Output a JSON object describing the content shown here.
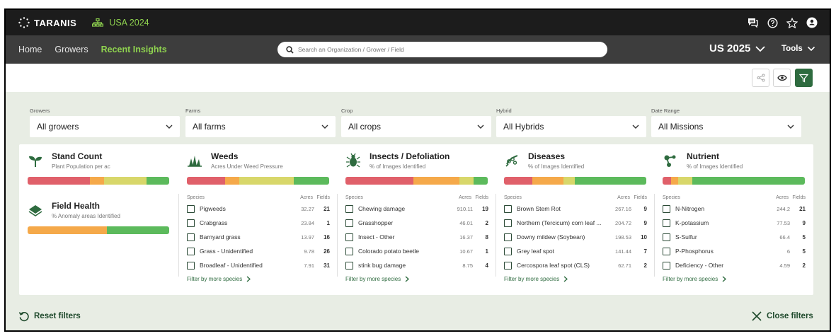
{
  "app": {
    "brand": "TARANIS",
    "region": "USA 2024"
  },
  "nav": {
    "items": [
      "Home",
      "Growers",
      "Recent Insights"
    ],
    "search_placeholder": "Search an Organization / Grower / Field",
    "season": "US 2025",
    "tools": "Tools"
  },
  "filters": [
    {
      "label": "Growers",
      "value": "All growers"
    },
    {
      "label": "Farms",
      "value": "All farms"
    },
    {
      "label": "Crop",
      "value": "All crops"
    },
    {
      "label": "Hybrid",
      "value": "All Hybrids"
    },
    {
      "label": "Date Range",
      "value": "All Missions"
    }
  ],
  "columns": [
    {
      "title": "Stand Count",
      "subtitle": "Plant Population per ac",
      "icon": "seedling-icon",
      "bar": [
        0.44,
        0.1,
        0.3,
        0.16
      ],
      "extra": {
        "title": "Field Health",
        "subtitle": "% Anomaly areas Identified",
        "icon": "field-layers-icon",
        "bar": [
          0,
          0.56,
          0,
          0.44
        ]
      }
    },
    {
      "title": "Weeds",
      "subtitle": "Acres Under Weed Pressure",
      "icon": "weed-icon",
      "bar": [
        0.27,
        0.1,
        0.38,
        0.25
      ],
      "headers": {
        "species": "Species",
        "acres": "Acres",
        "fields": "Fields"
      },
      "rows": [
        {
          "name": "Pigweeds",
          "acres": "32.27",
          "fields": "21"
        },
        {
          "name": "Crabgrass",
          "acres": "23.84",
          "fields": "1"
        },
        {
          "name": "Barnyard grass",
          "acres": "13.97",
          "fields": "16"
        },
        {
          "name": "Grass - Unidentified",
          "acres": "9.78",
          "fields": "26"
        },
        {
          "name": "Broadleaf - Unidentified",
          "acres": "7.91",
          "fields": "31"
        }
      ],
      "more": "Filter by more species"
    },
    {
      "title": "Insects / Defoliation",
      "subtitle": "% of Images Identified",
      "icon": "bug-icon",
      "bar": [
        0.48,
        0.32,
        0.1,
        0.1
      ],
      "headers": {
        "species": "Species",
        "acres": "Acres",
        "fields": "Fields"
      },
      "rows": [
        {
          "name": "Chewing damage",
          "acres": "910.11",
          "fields": "19"
        },
        {
          "name": "Grasshopper",
          "acres": "46.01",
          "fields": "2"
        },
        {
          "name": "Insect - Other",
          "acres": "16.37",
          "fields": "8"
        },
        {
          "name": "Colorado potato beetle",
          "acres": "10.67",
          "fields": "1"
        },
        {
          "name": "stink bug damage",
          "acres": "8.75",
          "fields": "4"
        }
      ],
      "more": "Filter by more species"
    },
    {
      "title": "Diseases",
      "subtitle": "% of Images Identified",
      "icon": "pathogen-icon",
      "bar": [
        0.2,
        0.22,
        0.08,
        0.5
      ],
      "headers": {
        "species": "Species",
        "acres": "Acres",
        "fields": "Fields"
      },
      "rows": [
        {
          "name": "Brown Stem Rot",
          "acres": "267.16",
          "fields": "9"
        },
        {
          "name": "Northern (Tercicum) corn leaf ...",
          "acres": "204.72",
          "fields": "9"
        },
        {
          "name": "Downy mildew (Soybean)",
          "acres": "198.53",
          "fields": "10"
        },
        {
          "name": "Grey leaf spot",
          "acres": "141.44",
          "fields": "7"
        },
        {
          "name": "Cercospora leaf spot (CLS)",
          "acres": "62.71",
          "fields": "2"
        }
      ],
      "more": "Filter by more species"
    },
    {
      "title": "Nutrient",
      "subtitle": "% of Images Identified",
      "icon": "molecule-icon",
      "bar": [
        0.06,
        0.05,
        0.1,
        0.79
      ],
      "headers": {
        "species": "Species",
        "acres": "Acres",
        "fields": "Fields"
      },
      "rows": [
        {
          "name": "N-Nitrogen",
          "acres": "244.2",
          "fields": "21"
        },
        {
          "name": "K-potassium",
          "acres": "77.53",
          "fields": "9"
        },
        {
          "name": "S-Sulfur",
          "acres": "66.4",
          "fields": "5"
        },
        {
          "name": "P-Phosphorus",
          "acres": "6",
          "fields": "5"
        },
        {
          "name": "Deficiency - Other",
          "acres": "4.59",
          "fields": "2"
        }
      ],
      "more": "Filter by more species"
    }
  ],
  "footer": {
    "reset": "Reset filters",
    "close": "Close filters"
  },
  "colors": {
    "accent_green": "#8fd34f",
    "dark_green": "#2e6b3f",
    "bar_red": "#e0606a",
    "bar_orange": "#f5a94a",
    "bar_yellow": "#d8d76a",
    "bar_green": "#5cba5c"
  }
}
